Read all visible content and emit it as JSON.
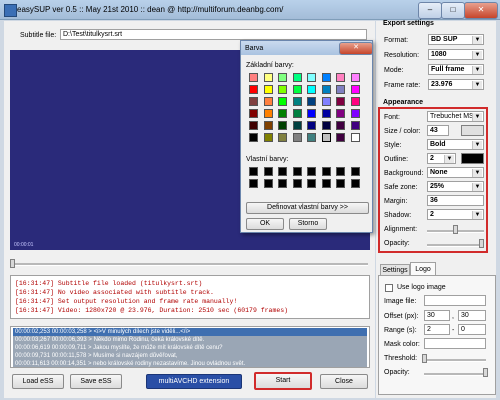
{
  "window": {
    "title": "easySUP ver 0.5 :: May 21st 2010 :: dean @ http://multiforum.deanbg.com/",
    "min_label": "–",
    "max_label": "□",
    "close_label": "✕"
  },
  "subtitle": {
    "label": "Subtitle file:",
    "value": "D:\\Test\\titulkysrt.srt"
  },
  "video": {
    "timecode": "00:00:01"
  },
  "log": {
    "lines": [
      "[16:31:47] Subtitle file loaded (titulkysrt.srt)",
      "[16:31:47] No video associated with subtitle track.",
      "[16:31:47] Set output resolution and frame rate manually!",
      "[16:31:47] Video: 1280x720 @ 23.976, Duration: 2510 sec (60179 frames)"
    ]
  },
  "subs": {
    "rows": [
      "00:00:02,253 00:00:03,258 > <i>V minulých dílech jste viděli...</i>",
      "00:00:03,267 00:00:06,393 > Někdo mimo Rodinu, čeká královské dítě.",
      "00:00:06,619 00:00:09,711 > Jakou myslíte, že může mít královské dítě cenu?",
      "00:00:09,731 00:00:11,578 > Musíme si navzájem důvěřovat,",
      "00:00:11,613 00:00:14,351 > nebo královské rodiny nezastavíme. Jinou ovládnou svět.",
      "00:00:14,360 00:00:16,010 > Ty jsi ten, kdo stojí v cestě,",
      "00:00:16,040 00:00:18,229 > ..."
    ]
  },
  "buttons": {
    "load": "Load eSS",
    "save": "Save eSS",
    "ext": "multiAVCHD extension",
    "start": "Start",
    "close": "Close"
  },
  "export": {
    "title": "Export settings",
    "format_label": "Format:",
    "format": "BD SUP",
    "resolution_label": "Resolution:",
    "resolution": "1080",
    "mode_label": "Mode:",
    "mode": "Full frame",
    "fps_label": "Frame rate:",
    "fps": "23.976"
  },
  "appearance": {
    "title": "Appearance",
    "font_label": "Font:",
    "font": "Trebuchet MS",
    "size_label": "Size / color:",
    "size": "43",
    "style_label": "Style:",
    "style": "Bold",
    "outline_label": "Outline:",
    "outline": "2",
    "background_label": "Background:",
    "background": "None",
    "safezone_label": "Safe zone:",
    "safezone": "25%",
    "margin_label": "Margin:",
    "margin": "36",
    "shadow_label": "Shadow:",
    "shadow": "2",
    "alignment_label": "Alignment:",
    "opacity_label": "Opacity:"
  },
  "tabs": {
    "settings": "Settings",
    "logo": "Logo"
  },
  "logo": {
    "use_label": "Use logo image",
    "file_label": "Image file:",
    "offset_label": "Offset (px):",
    "offset_x": "30",
    "offset_y": "30",
    "range_label": "Range (s):",
    "range_a": "2",
    "range_sep": "-",
    "range_b": "0",
    "mask_label": "Mask color:",
    "threshold_label": "Threshold:",
    "opacity_label": "Opacity:"
  },
  "color_dialog": {
    "title": "Barva",
    "basic_label": "Základní barvy:",
    "custom_label": "Vlastní barvy:",
    "define_button": "Definovat vlastní barvy >>",
    "ok": "OK",
    "cancel": "Storno",
    "basic_colors": [
      "#ff8080",
      "#ffff80",
      "#80ff80",
      "#00ff80",
      "#80ffff",
      "#0080ff",
      "#ff80c0",
      "#ff80ff",
      "#ff0000",
      "#ffff00",
      "#80ff00",
      "#00ff40",
      "#00ffff",
      "#0080c0",
      "#8080c0",
      "#ff00ff",
      "#804040",
      "#ff8040",
      "#00ff00",
      "#008080",
      "#004080",
      "#8080ff",
      "#800040",
      "#ff0080",
      "#800000",
      "#ff8000",
      "#008000",
      "#008040",
      "#0000ff",
      "#0000a0",
      "#800080",
      "#8000ff",
      "#400000",
      "#804000",
      "#004000",
      "#004040",
      "#000080",
      "#000040",
      "#400040",
      "#400080",
      "#000000",
      "#808000",
      "#808040",
      "#808080",
      "#408080",
      "#c0c0c0",
      "#400040",
      "#ffffff"
    ]
  },
  "colors": {
    "highlight": "#d12b2b",
    "video_bg": "#2a2a7a",
    "selected_row": "#3f6fb0",
    "size_color": "#e0e0e0",
    "outline_color": "#000000"
  }
}
